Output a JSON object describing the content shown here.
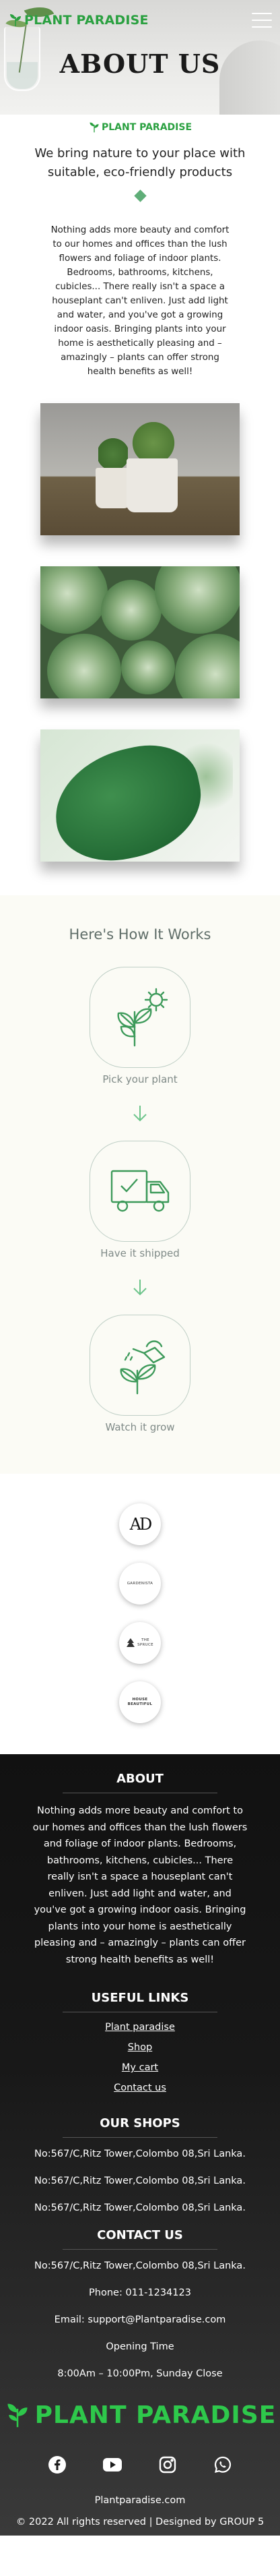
{
  "header": {
    "brand": "PLANT  PARADISE",
    "menu_icon": "hamburger-icon"
  },
  "hero": {
    "title": "ABOUT US"
  },
  "intro": {
    "brand": "PLANT  PARADISE",
    "tagline": "We bring nature to your place with suitable, eco-friendly products",
    "paragraph": "Nothing adds more beauty and comfort to our homes and offices than the lush flowers and foliage of indoor plants. Bedrooms, bathrooms, kitchens, cubicles... There really isn't a space a houseplant can't enliven. Just add light and water, and you've got a growing indoor oasis. Bringing plants into your home is aesthetically pleasing and – amazingly – plants can offer strong health benefits as well!"
  },
  "how_it_works": {
    "title": "Here's How It Works",
    "steps": [
      {
        "label": "Pick your plant",
        "icon": "plant-pick-icon"
      },
      {
        "label": "Have it shipped",
        "icon": "delivery-truck-icon"
      },
      {
        "label": "Watch it grow",
        "icon": "watering-can-icon"
      }
    ]
  },
  "partners": [
    {
      "text": "AD"
    },
    {
      "text": "GARDENISTA"
    },
    {
      "text": "THE SPRUCE"
    },
    {
      "text": "HOUSE BEAUTIFUL"
    }
  ],
  "footer": {
    "about_title": "ABOUT",
    "about_text": "Nothing adds more beauty and comfort to our homes and offices than the lush flowers and foliage of indoor plants. Bedrooms, bathrooms, kitchens, cubicles... There really isn't a space a houseplant can't enliven. Just add light and water, and you've got a growing indoor oasis. Bringing plants into your home is aesthetically pleasing and – amazingly – plants can offer strong health benefits as well!",
    "links_title": "USEFUL LINKS",
    "links": [
      "Plant paradise",
      "Shop",
      "My cart",
      "Contact us"
    ],
    "shops_title": "OUR SHOPS",
    "shops": [
      "No:567/C,Ritz Tower,Colombo 08,Sri Lanka.",
      "No:567/C,Ritz Tower,Colombo 08,Sri Lanka.",
      "No:567/C,Ritz Tower,Colombo 08,Sri Lanka."
    ],
    "contact_title": "CONTACT US",
    "contact": {
      "address": "No:567/C,Ritz Tower,Colombo 08,Sri Lanka.",
      "phone": "Phone: 011-1234123",
      "email": "Email: support@Plantparadise.com",
      "hours_title": "Opening Time",
      "hours": "8:00Am – 10:00Pm, Sunday Close"
    },
    "brand": "PLANT  PARADISE",
    "socials": [
      "facebook-icon",
      "youtube-icon",
      "instagram-icon",
      "whatsapp-icon"
    ],
    "site": "Plantparadise.com",
    "copyright": "© 2022 All rights reserved | Designed by GROUP 5"
  },
  "colors": {
    "brand_green": "#2aa040",
    "footer_green": "#2ec84b",
    "accent": "#5fae78",
    "how_bg": "#fbfbf5",
    "footer_bg": "#111111"
  }
}
